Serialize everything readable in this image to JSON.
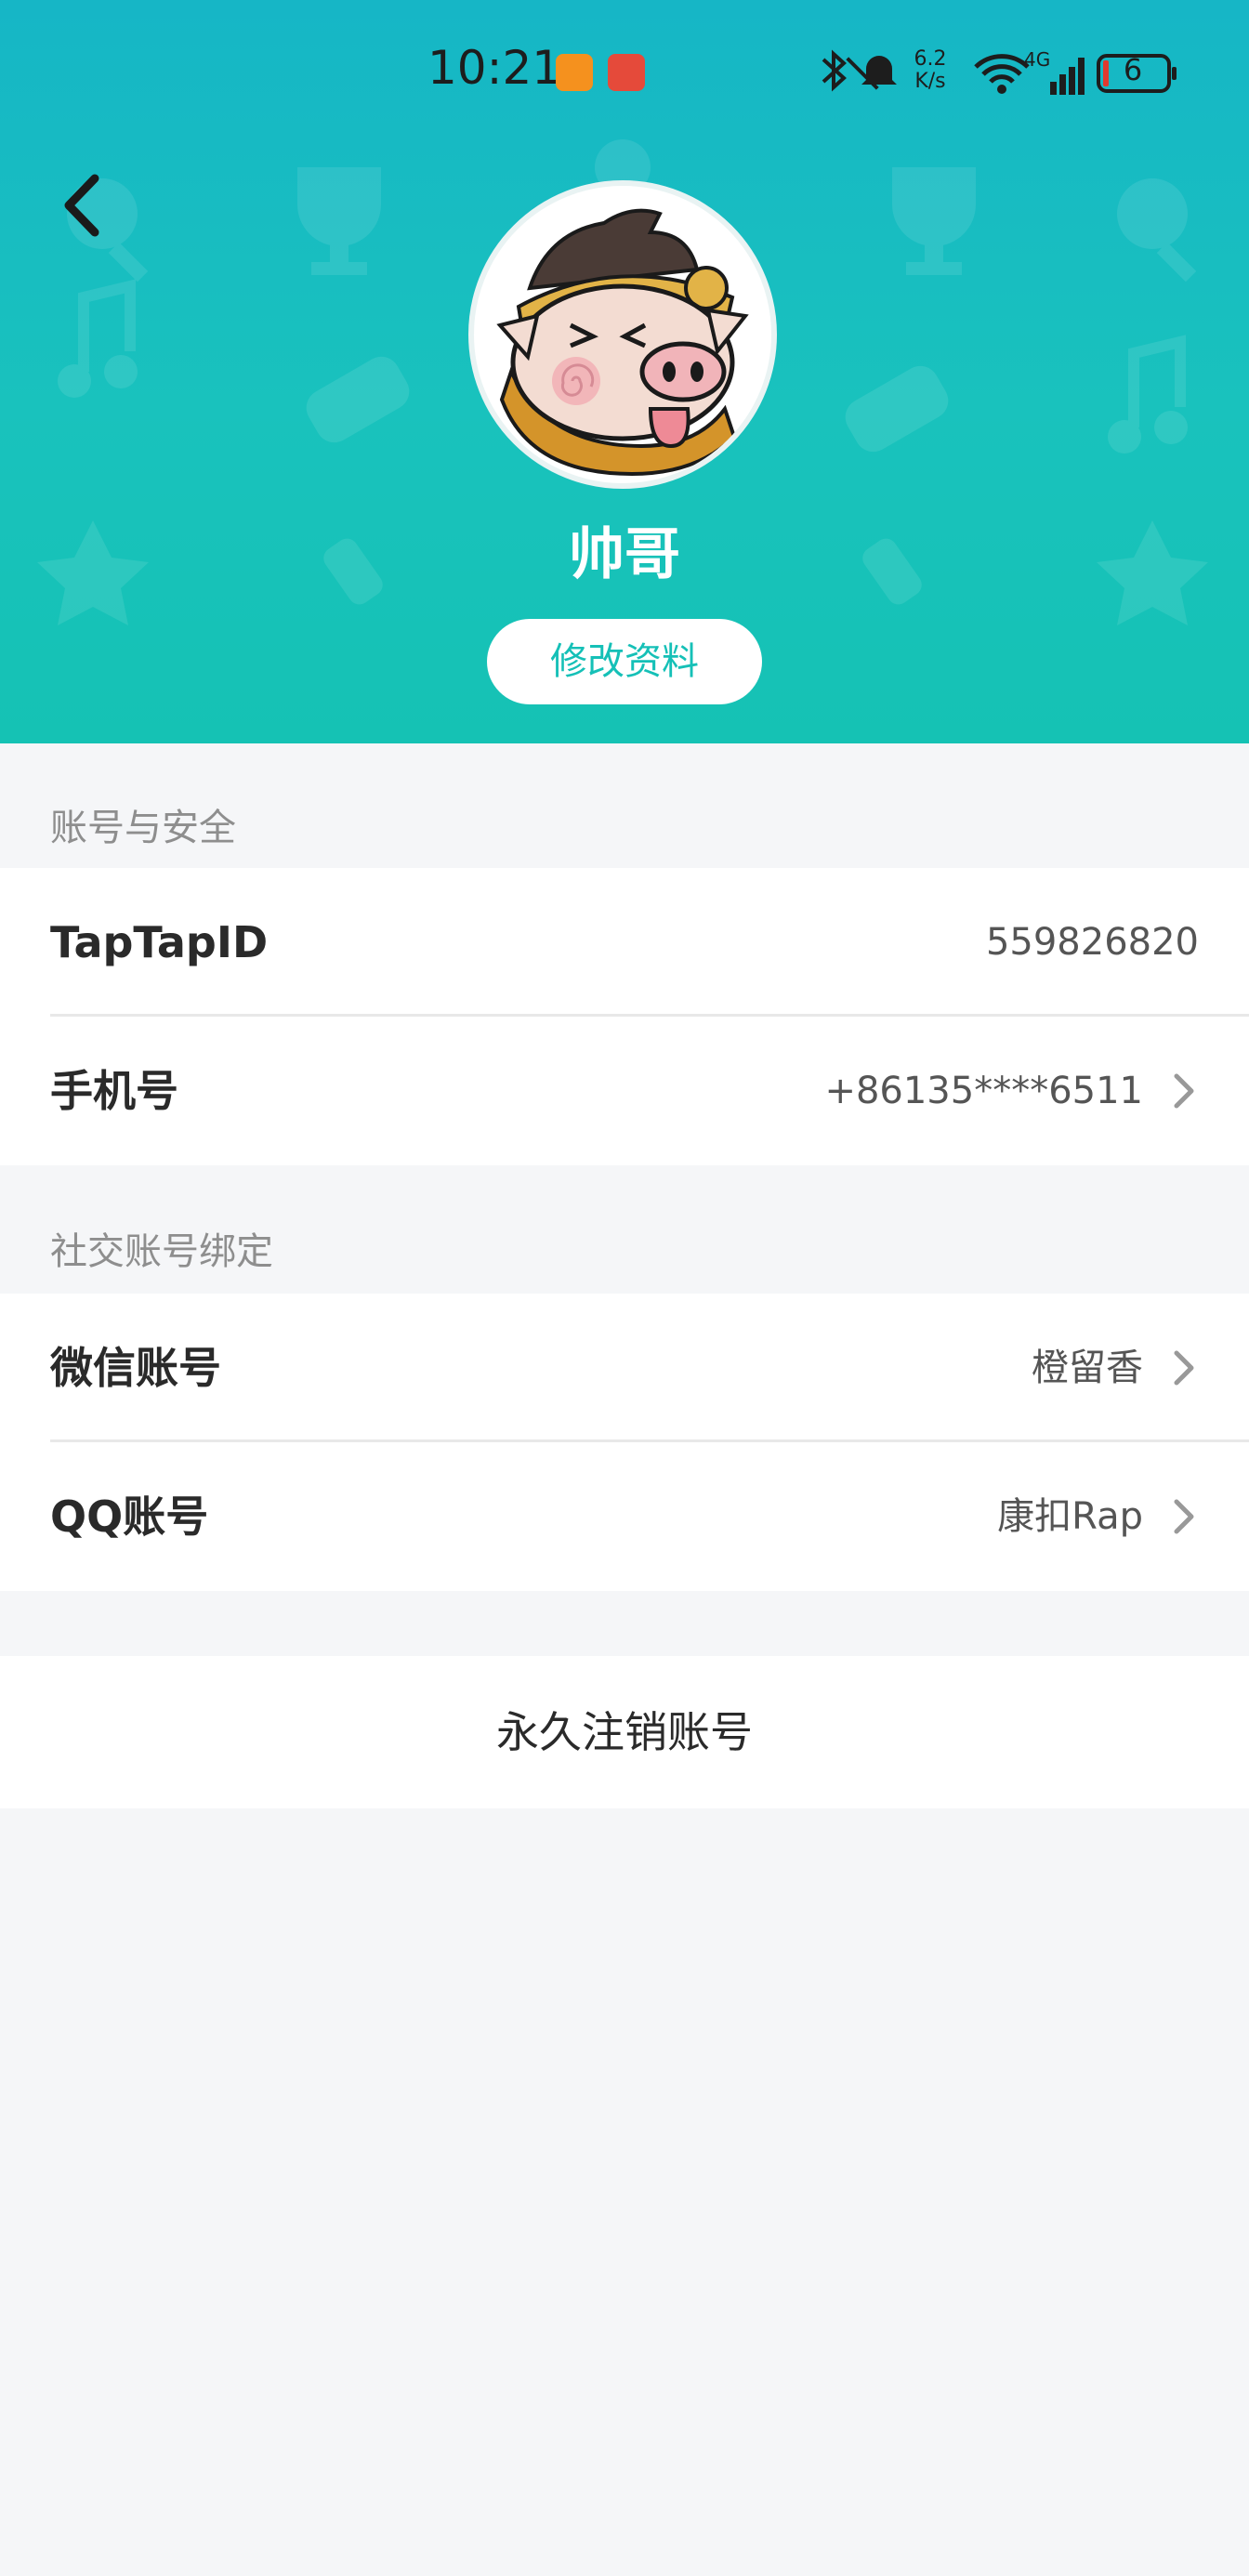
{
  "status_bar": {
    "time": "10:21",
    "net_speed_value": "6.2",
    "net_speed_unit": "K/s",
    "network_type": "4G",
    "battery_level": "6"
  },
  "profile": {
    "username": "帅哥",
    "edit_button_label": "修改资料"
  },
  "account_security": {
    "section_title": "账号与安全",
    "rows": [
      {
        "label": "TapTapID",
        "value": "559826820",
        "has_chevron": false
      },
      {
        "label": "手机号",
        "value": "+86135****6511",
        "has_chevron": true
      }
    ]
  },
  "social_binding": {
    "section_title": "社交账号绑定",
    "rows": [
      {
        "label": "微信账号",
        "value": "橙留香",
        "has_chevron": true
      },
      {
        "label": "QQ账号",
        "value": "康扣Rap",
        "has_chevron": true
      }
    ]
  },
  "delete_account_label": "永久注销账号",
  "colors": {
    "header_gradient_top": "#16b6c6",
    "header_gradient_bottom": "#15c2b4",
    "accent": "#15c0b7",
    "page_background": "#f5f6f8"
  },
  "icons": [
    "back-arrow-icon",
    "chevron-right-icon",
    "bluetooth-icon",
    "mute-icon",
    "wifi-icon",
    "signal-icon",
    "battery-icon"
  ]
}
